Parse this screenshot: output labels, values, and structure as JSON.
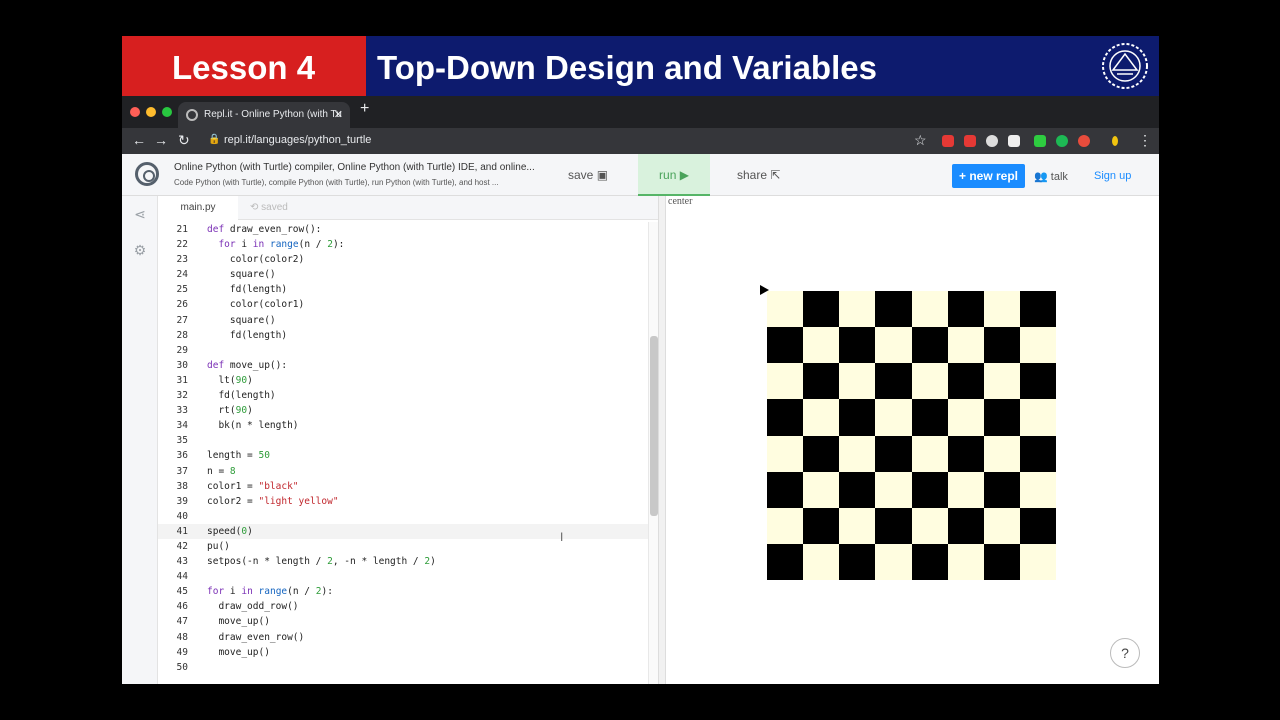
{
  "banner": {
    "lesson": "Lesson 4",
    "title": "Top-Down Design and Variables"
  },
  "browser": {
    "tab_title": "Repl.it - Online Python (with Tu",
    "tab_close": "✕",
    "new_tab": "+",
    "back": "←",
    "forward": "→",
    "reload": "↻",
    "url": "repl.it/languages/python_turtle",
    "star": "☆",
    "menu": "⋮",
    "traffic_colors": [
      "#ff5f57",
      "#febc2e",
      "#28c840"
    ]
  },
  "repl": {
    "title": "Online Python (with Turtle) compiler, Online Python (with Turtle) IDE, and online...",
    "subtitle": "Code Python (with Turtle), compile Python (with Turtle), run Python (with Turtle), and host ...",
    "save_label": "save",
    "run_label": "run ▶",
    "share_label": "share",
    "new_repl_label": "+ new repl",
    "talk_label": "talk",
    "signup_label": "Sign up"
  },
  "editor": {
    "file_name": "main.py",
    "status": "saved",
    "active_line": 41,
    "lines": [
      {
        "n": "21",
        "html": "<span class=\"kw\">def</span> draw_even_row():"
      },
      {
        "n": "22",
        "html": "  <span class=\"kw\">for</span> i <span class=\"kw\">in</span> <span class=\"fn\">range</span>(n / <span class=\"num\">2</span>):"
      },
      {
        "n": "23",
        "html": "    color(color2)"
      },
      {
        "n": "24",
        "html": "    square()"
      },
      {
        "n": "25",
        "html": "    fd(length)"
      },
      {
        "n": "26",
        "html": "    color(color1)"
      },
      {
        "n": "27",
        "html": "    square()"
      },
      {
        "n": "28",
        "html": "    fd(length)"
      },
      {
        "n": "29",
        "html": ""
      },
      {
        "n": "30",
        "html": "<span class=\"kw\">def</span> move_up():"
      },
      {
        "n": "31",
        "html": "  lt(<span class=\"num\">90</span>)"
      },
      {
        "n": "32",
        "html": "  fd(length)"
      },
      {
        "n": "33",
        "html": "  rt(<span class=\"num\">90</span>)"
      },
      {
        "n": "34",
        "html": "  bk(n * length)"
      },
      {
        "n": "35",
        "html": ""
      },
      {
        "n": "36",
        "html": "length = <span class=\"num\">50</span>"
      },
      {
        "n": "37",
        "html": "n = <span class=\"num\">8</span>"
      },
      {
        "n": "38",
        "html": "color1 = <span class=\"str\">\"black\"</span>"
      },
      {
        "n": "39",
        "html": "color2 = <span class=\"str\">\"light yellow\"</span>"
      },
      {
        "n": "40",
        "html": ""
      },
      {
        "n": "41",
        "html": "speed(<span class=\"num\">0</span>)"
      },
      {
        "n": "42",
        "html": "pu()"
      },
      {
        "n": "43",
        "html": "setpos(-n * length / <span class=\"num\">2</span>, -n * length / <span class=\"num\">2</span>)"
      },
      {
        "n": "44",
        "html": ""
      },
      {
        "n": "45",
        "html": "<span class=\"kw\">for</span> i <span class=\"kw\">in</span> <span class=\"fn\">range</span>(n / <span class=\"num\">2</span>):"
      },
      {
        "n": "46",
        "html": "  draw_odd_row()"
      },
      {
        "n": "47",
        "html": "  move_up()"
      },
      {
        "n": "48",
        "html": "  draw_even_row()"
      },
      {
        "n": "49",
        "html": "  move_up()"
      },
      {
        "n": "50",
        "html": ""
      }
    ]
  },
  "output": {
    "canvas_label": "center",
    "board_size": 8,
    "color1": "#000000",
    "color2": "#fffde0",
    "help_label": "?"
  }
}
